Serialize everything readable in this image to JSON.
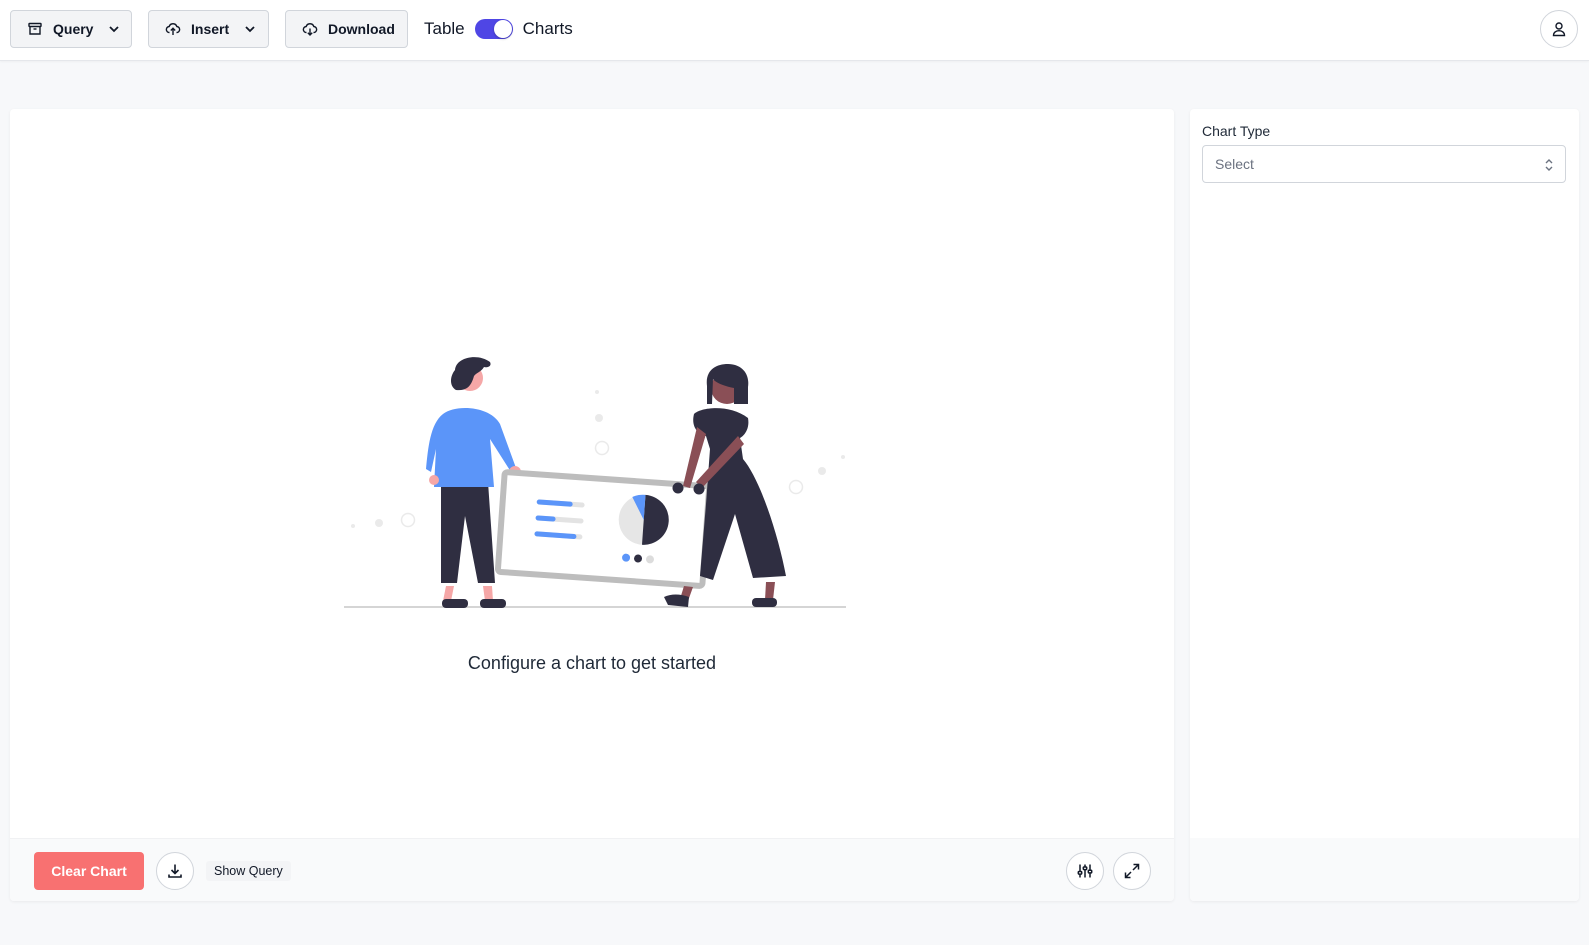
{
  "toolbar": {
    "query_label": "Query",
    "insert_label": "Insert",
    "download_label": "Download",
    "view_toggle": {
      "left_label": "Table",
      "right_label": "Charts",
      "selected": "Charts",
      "accent_color": "#4f46e5"
    },
    "icons": {
      "query": "archive-icon",
      "insert": "cloud-upload-icon",
      "download": "cloud-download-icon",
      "dropdown": "chevron-down-icon",
      "user": "user-icon"
    }
  },
  "chart_panel": {
    "empty_message": "Configure a chart to get started",
    "illustration": "people-carrying-chart-board-illustration",
    "footer": {
      "clear_label": "Clear Chart",
      "clear_color": "#f87171",
      "show_query_label": "Show Query",
      "icons": {
        "download": "download-icon",
        "settings": "sliders-icon",
        "expand": "expand-icon"
      }
    }
  },
  "settings_panel": {
    "chart_type_label": "Chart Type",
    "chart_type_placeholder": "Select"
  }
}
